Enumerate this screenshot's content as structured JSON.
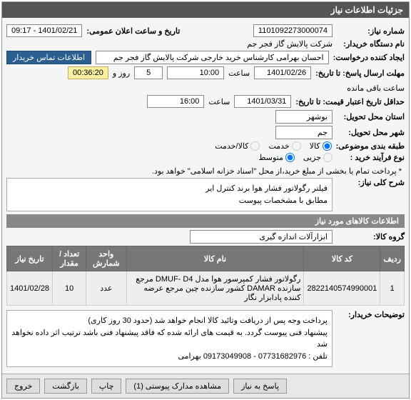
{
  "panel_title": "جزئیات اطلاعات نیاز",
  "fields": {
    "niaz_no_label": "شماره نیاز:",
    "niaz_no": "1101092273000074",
    "announce_label": "تاریخ و ساعت اعلان عمومی:",
    "announce_value": "1401/02/21 - 09:17",
    "buyer_unit_label": "نام دستگاه خریدار:",
    "buyer_unit": "شرکت پالایش گاز فجر جم",
    "requester_label": "ایجاد کننده درخواست:",
    "requester": "احسان بهرامی کارشناس خرید خارجی شرکت پالایش گاز فجر جم",
    "contact_btn": "اطلاعات تماس خریدار",
    "deadline_label": "مهلت ارسال پاسخ: تا تاریخ:",
    "deadline_date": "1401/02/26",
    "saat": "ساعت",
    "deadline_time": "10:00",
    "days": "5",
    "rooz_va": "روز و",
    "countdown": "00:36:20",
    "remain": "ساعت باقی مانده",
    "validity_label": "حداقل تاریخ اعتبار قیمت: تا تاریخ:",
    "validity_date": "1401/03/31",
    "validity_time": "16:00",
    "province_label": "استان محل تحویل:",
    "province": "بوشهر",
    "city_label": "شهر محل تحویل:",
    "city": "جم",
    "category_label": "طبقه بندی موضوعی:",
    "cat_goods": "کالا",
    "cat_service": "خدمت",
    "cat_both": "کالا/خدمت",
    "buy_type_label": "نوع فرآیند خرید :",
    "bt_small": "جزیی",
    "bt_medium": "متوسط",
    "bt_note": "* پرداخت تمام یا بخشی از مبلغ خرید،از محل \"اسناد خزانه اسلامی\" خواهد بود.",
    "desc_label": "شرح کلی نیاز:",
    "desc_text": "فیلتر رگولاتور فشار هوا برند کنترل ایر\nمطابق با مشخصات پیوست",
    "items_title": "اطلاعات کالاهای مورد نیاز",
    "group_label": "گروه کالا:",
    "group_value": "ابزارآلات اندازه گیری",
    "buyer_notes_label": "توضیحات خریدار:",
    "buyer_notes": "پرداخت وجه پس از دریافت وتائید کالا انجام خواهد شد (حدود 30 روز کاری)\nپیشنهاد فنی پیوست گردد. به قیمت های ارائه شده که فاقد پیشنهاد فنی باشد ترتیب اثر داده نخواهد شد\nتلفن : 07731682976 - 09173049908 بهرامی"
  },
  "table": {
    "headers": {
      "row": "ردیف",
      "code": "کد کالا",
      "name": "نام کالا",
      "unit": "واحد شمارش",
      "qty": "تعداد / مقدار",
      "date": "تاریخ نیاز"
    },
    "rows": [
      {
        "row": "1",
        "code": "2822140574990001",
        "name": "رگولاتور فشار کمپرسور هوا مدل DMUF- D4 مرجع سازنده DAMAR کشور سازنده چین مرجع عرضه کننده پادابزار نگار",
        "unit": "عدد",
        "qty": "10",
        "date": "1401/02/28"
      }
    ]
  },
  "footer": {
    "reply": "پاسخ به نیاز",
    "attach": "مشاهده مدارک پیوستی (1)",
    "print": "چاپ",
    "back": "بازگشت",
    "exit": "خروج"
  }
}
